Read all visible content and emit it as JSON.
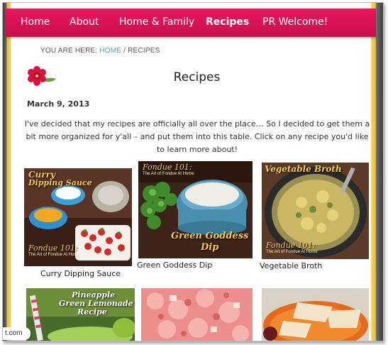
{
  "nav": {
    "items": [
      {
        "label": "Home",
        "active": false
      },
      {
        "label": "About",
        "active": false
      },
      {
        "label": "Home & Family",
        "active": false
      },
      {
        "label": "Recipes",
        "active": true
      },
      {
        "label": "PR Welcome!",
        "active": false
      }
    ],
    "color": "#d8124f"
  },
  "breadcrumb": {
    "prefix": "YOU ARE HERE:",
    "home_link": "HOME",
    "separator": " / ",
    "current": "RECIPES"
  },
  "page": {
    "title": "Recipes",
    "date": "March 9, 2013",
    "intro": "I've decided that my recipes are officially all over the place… So I decided to get them a bit more organized for y'all – and put them into this table. Click on any recipe you'd like to learn more about!"
  },
  "recipes": [
    {
      "caption": "Curry Dipping Sauce",
      "overlay_title_1": "Curry",
      "overlay_title_2": "Dipping Sauce",
      "overlay_brand": "Fondue 101:",
      "overlay_sub": "The Art of Fondue At Home"
    },
    {
      "caption": "Green Goddess Dip",
      "overlay_title_1": "Green Goddess",
      "overlay_title_2": "Dip",
      "overlay_brand": "Fondue 101:",
      "overlay_sub": "The Art of Fondue At Home"
    },
    {
      "caption": "Vegetable Broth",
      "overlay_title_1": "Vegetable Broth",
      "overlay_brand": "Fondue 101:",
      "overlay_sub": "The Art of Fondue At Home"
    },
    {
      "overlay_title_1": "Pineapple",
      "overlay_title_2": "Green Lemonade",
      "overlay_title_3": "Recipe"
    },
    {},
    {}
  ],
  "url_fragment": "t.com",
  "colors": {
    "accent": "#d8124f",
    "link": "#5a9fae",
    "side_border": "#e7c23e"
  }
}
